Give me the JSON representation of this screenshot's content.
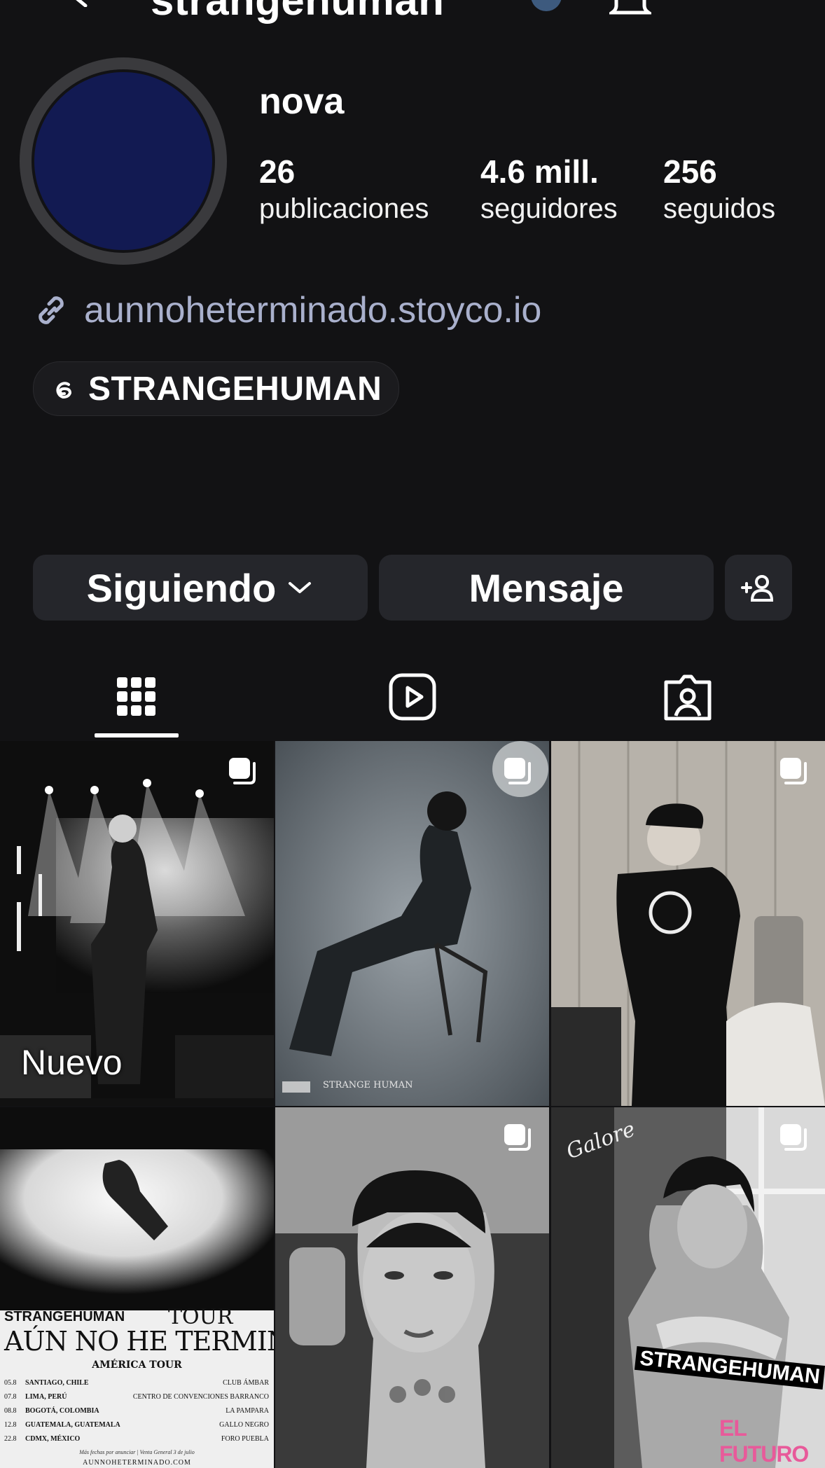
{
  "header": {
    "username": "strangehuman"
  },
  "profile": {
    "display_name": "nova",
    "stats": [
      {
        "value": "26",
        "label": "publicaciones"
      },
      {
        "value": "4.6 mill.",
        "label": "seguidores"
      },
      {
        "value": "256",
        "label": "seguidos"
      }
    ],
    "link": "aunnoheterminado.stoyco.io",
    "threads_handle": "STRANGEHUMAN"
  },
  "actions": {
    "follow_label": "Siguiendo",
    "message_label": "Mensaje"
  },
  "tabs": [
    {
      "icon": "grid-icon",
      "active": true
    },
    {
      "icon": "reels-icon",
      "active": false
    },
    {
      "icon": "tagged-icon",
      "active": false
    }
  ],
  "grid": {
    "posts": [
      {
        "badge": "Nuevo",
        "multi": true
      },
      {
        "caption": "STRANGE HUMAN",
        "multi": true
      },
      {
        "multi": true
      },
      {
        "tour_title": "AÚN NO HE TERMINADO",
        "tour_brand": "STRANGEHUMAN",
        "tour_label": "TOUR",
        "tour_sub": "AMÉRICA TOUR",
        "dates": [
          {
            "date": "05.8",
            "city": "SANTIAGO, CHILE",
            "venue": "CLUB ÁMBAR"
          },
          {
            "date": "07.8",
            "city": "LIMA, PERÚ",
            "venue": "CENTRO DE CONVENCIONES BARRANCO"
          },
          {
            "date": "08.8",
            "city": "BOGOTÁ, COLOMBIA",
            "venue": "LA PAMPARA"
          },
          {
            "date": "12.8",
            "city": "GUATEMALA, GUATEMALA",
            "venue": "GALLO NEGRO"
          },
          {
            "date": "22.8",
            "city": "CDMX, MÉXICO",
            "venue": "FORO PUEBLA"
          }
        ],
        "footnote": "Más fechas por anunciar | Venta General 3 de julio",
        "site": "AUNNOHETERMINADO.COM",
        "multi": false
      },
      {
        "multi": true
      },
      {
        "overlay_text": "STRANGEHUMAN",
        "overlay_pink": "EL FUTURO",
        "script": "Galore",
        "multi": true
      }
    ]
  }
}
